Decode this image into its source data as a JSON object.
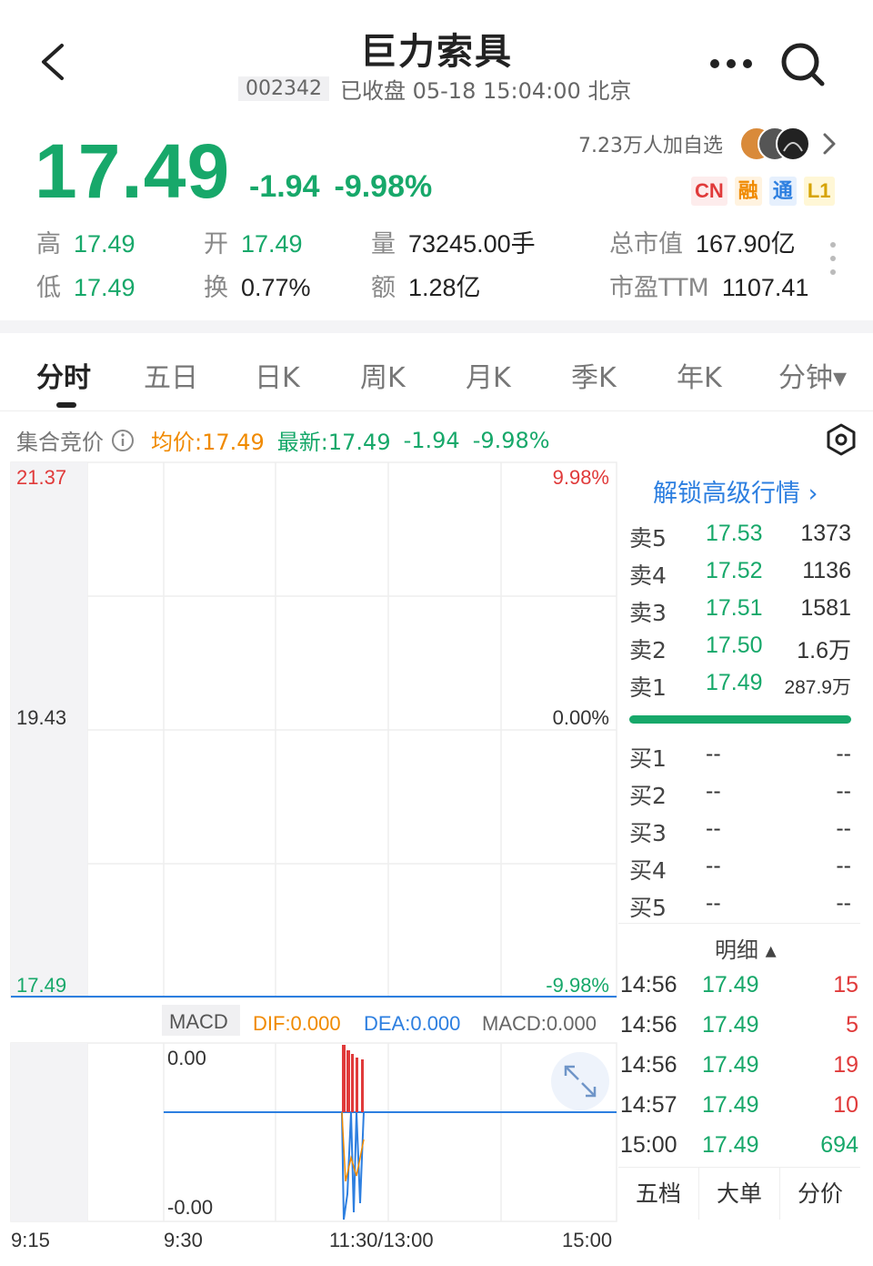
{
  "header": {
    "title": "巨力索具",
    "code": "002342",
    "status": "已收盘 05-18 15:04:00 北京",
    "price": "17.49",
    "change": "-1.94",
    "change_pct": "-9.98%",
    "followers": "7.23万人加自选",
    "badges": [
      "CN",
      "融",
      "通",
      "L1"
    ]
  },
  "stats": {
    "high_label": "高",
    "high": "17.49",
    "open_label": "开",
    "open": "17.49",
    "volume_label": "量",
    "volume": "73245.00手",
    "mktcap_label": "总市值",
    "mktcap": "167.90亿",
    "low_label": "低",
    "low": "17.49",
    "turnover_label": "换",
    "turnover": "0.77%",
    "amount_label": "额",
    "amount": "1.28亿",
    "pe_label": "市盈TTM",
    "pe": "1107.41"
  },
  "tabs": [
    "分时",
    "五日",
    "日K",
    "周K",
    "月K",
    "季K",
    "年K",
    "分钟▾"
  ],
  "info_bar": {
    "auction": "集合竞价",
    "avg": "均价:17.49",
    "latest": "最新:17.49",
    "change": "-1.94",
    "change_pct": "-9.98%"
  },
  "price_axis": {
    "top": "21.37",
    "mid": "19.43",
    "bottom": "17.49",
    "top_pct": "9.98%",
    "mid_pct": "0.00%",
    "bottom_pct": "-9.98%"
  },
  "macd": {
    "label": "MACD",
    "dif": "DIF:0.000",
    "dea": "DEA:0.000",
    "macd": "MACD:0.000",
    "top": "0.00",
    "bottom": "-0.00"
  },
  "time_axis": [
    "9:15",
    "9:30",
    "11:30/13:00",
    "15:00"
  ],
  "orderbook": {
    "unlock": "解锁高级行情 ›",
    "asks": [
      {
        "label": "卖5",
        "price": "17.53",
        "vol": "1373"
      },
      {
        "label": "卖4",
        "price": "17.52",
        "vol": "1136"
      },
      {
        "label": "卖3",
        "price": "17.51",
        "vol": "1581"
      },
      {
        "label": "卖2",
        "price": "17.50",
        "vol": "1.6万"
      },
      {
        "label": "卖1",
        "price": "17.49",
        "vol": "287.9万"
      }
    ],
    "bids": [
      {
        "label": "买1",
        "price": "--",
        "vol": "--"
      },
      {
        "label": "买2",
        "price": "--",
        "vol": "--"
      },
      {
        "label": "买3",
        "price": "--",
        "vol": "--"
      },
      {
        "label": "买4",
        "price": "--",
        "vol": "--"
      },
      {
        "label": "买5",
        "price": "--",
        "vol": "--"
      }
    ]
  },
  "ticks": {
    "title": "明细 ▴",
    "rows": [
      {
        "time": "14:56",
        "price": "17.49",
        "vol": "15",
        "dir": "buy"
      },
      {
        "time": "14:56",
        "price": "17.49",
        "vol": "5",
        "dir": "buy"
      },
      {
        "time": "14:56",
        "price": "17.49",
        "vol": "19",
        "dir": "buy"
      },
      {
        "time": "14:57",
        "price": "17.49",
        "vol": "10",
        "dir": "buy"
      },
      {
        "time": "15:00",
        "price": "17.49",
        "vol": "694",
        "dir": "sell"
      }
    ]
  },
  "bottom_tabs": [
    "五档",
    "大单",
    "分价"
  ],
  "colors": {
    "up": "#e03a3a",
    "down": "#17a86a",
    "avg": "#f08a00",
    "accent": "#2d7fe0"
  }
}
